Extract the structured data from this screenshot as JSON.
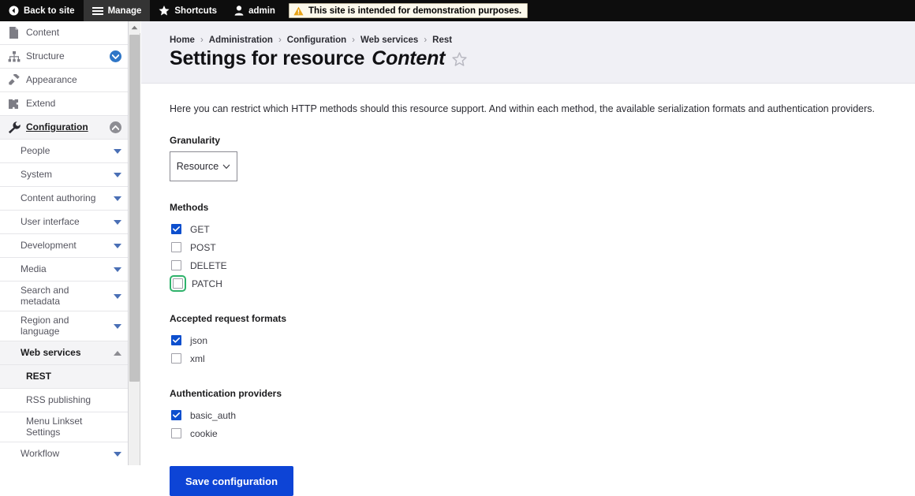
{
  "toolbar": {
    "back_to_site": "Back to site",
    "manage": "Manage",
    "shortcuts": "Shortcuts",
    "account": "admin",
    "warning": "This site is intended for demonstration purposes."
  },
  "sidebar": {
    "items": [
      {
        "label": "Content",
        "icon": "document-icon",
        "toggle": "none"
      },
      {
        "label": "Structure",
        "icon": "structure-icon",
        "toggle": "circle-chevron-down"
      },
      {
        "label": "Appearance",
        "icon": "brush-icon",
        "toggle": "none"
      },
      {
        "label": "Extend",
        "icon": "puzzle-icon",
        "toggle": "none"
      },
      {
        "label": "Configuration",
        "icon": "wrench-icon",
        "toggle": "circle-chevron-up"
      }
    ],
    "config_children": [
      {
        "label": "People",
        "toggle": "triangle-down"
      },
      {
        "label": "System",
        "toggle": "triangle-down"
      },
      {
        "label": "Content authoring",
        "toggle": "triangle-down"
      },
      {
        "label": "User interface",
        "toggle": "triangle-down"
      },
      {
        "label": "Development",
        "toggle": "triangle-down"
      },
      {
        "label": "Media",
        "toggle": "triangle-down"
      },
      {
        "label": "Search and metadata",
        "toggle": "triangle-down"
      },
      {
        "label": "Region and language",
        "toggle": "triangle-down"
      },
      {
        "label": "Web services",
        "toggle": "triangle-up"
      }
    ],
    "web_services_children": [
      {
        "label": "REST"
      },
      {
        "label": "RSS publishing"
      },
      {
        "label": "Menu Linkset Settings"
      }
    ],
    "after": [
      {
        "label": "Workflow",
        "toggle": "triangle-down"
      }
    ]
  },
  "breadcrumb": [
    "Home",
    "Administration",
    "Configuration",
    "Web services",
    "Rest"
  ],
  "page": {
    "title_prefix": "Settings for resource",
    "title_resource": "Content",
    "bookmark_icon": "star-outline-icon",
    "intro": "Here you can restrict which HTTP methods should this resource support. And within each method, the available serialization formats and authentication providers."
  },
  "form": {
    "granularity": {
      "label": "Granularity",
      "value": "Resource"
    },
    "methods": {
      "label": "Methods",
      "options": [
        {
          "label": "GET",
          "checked": true,
          "focused": false
        },
        {
          "label": "POST",
          "checked": false,
          "focused": false
        },
        {
          "label": "DELETE",
          "checked": false,
          "focused": false
        },
        {
          "label": "PATCH",
          "checked": false,
          "focused": true
        }
      ]
    },
    "formats": {
      "label": "Accepted request formats",
      "options": [
        {
          "label": "json",
          "checked": true,
          "focused": false
        },
        {
          "label": "xml",
          "checked": false,
          "focused": false
        }
      ]
    },
    "auth": {
      "label": "Authentication providers",
      "options": [
        {
          "label": "basic_auth",
          "checked": true,
          "focused": false
        },
        {
          "label": "cookie",
          "checked": false,
          "focused": false
        }
      ]
    },
    "save_label": "Save configuration"
  },
  "colors": {
    "toolbar_bg": "#0d0d0d",
    "accent_blue": "#0d44d6",
    "checkbox_blue": "#0d4fce",
    "focus_green": "#2fb26b",
    "warning_bg": "#fcf9ec",
    "header_bg": "#f0f0f5"
  }
}
